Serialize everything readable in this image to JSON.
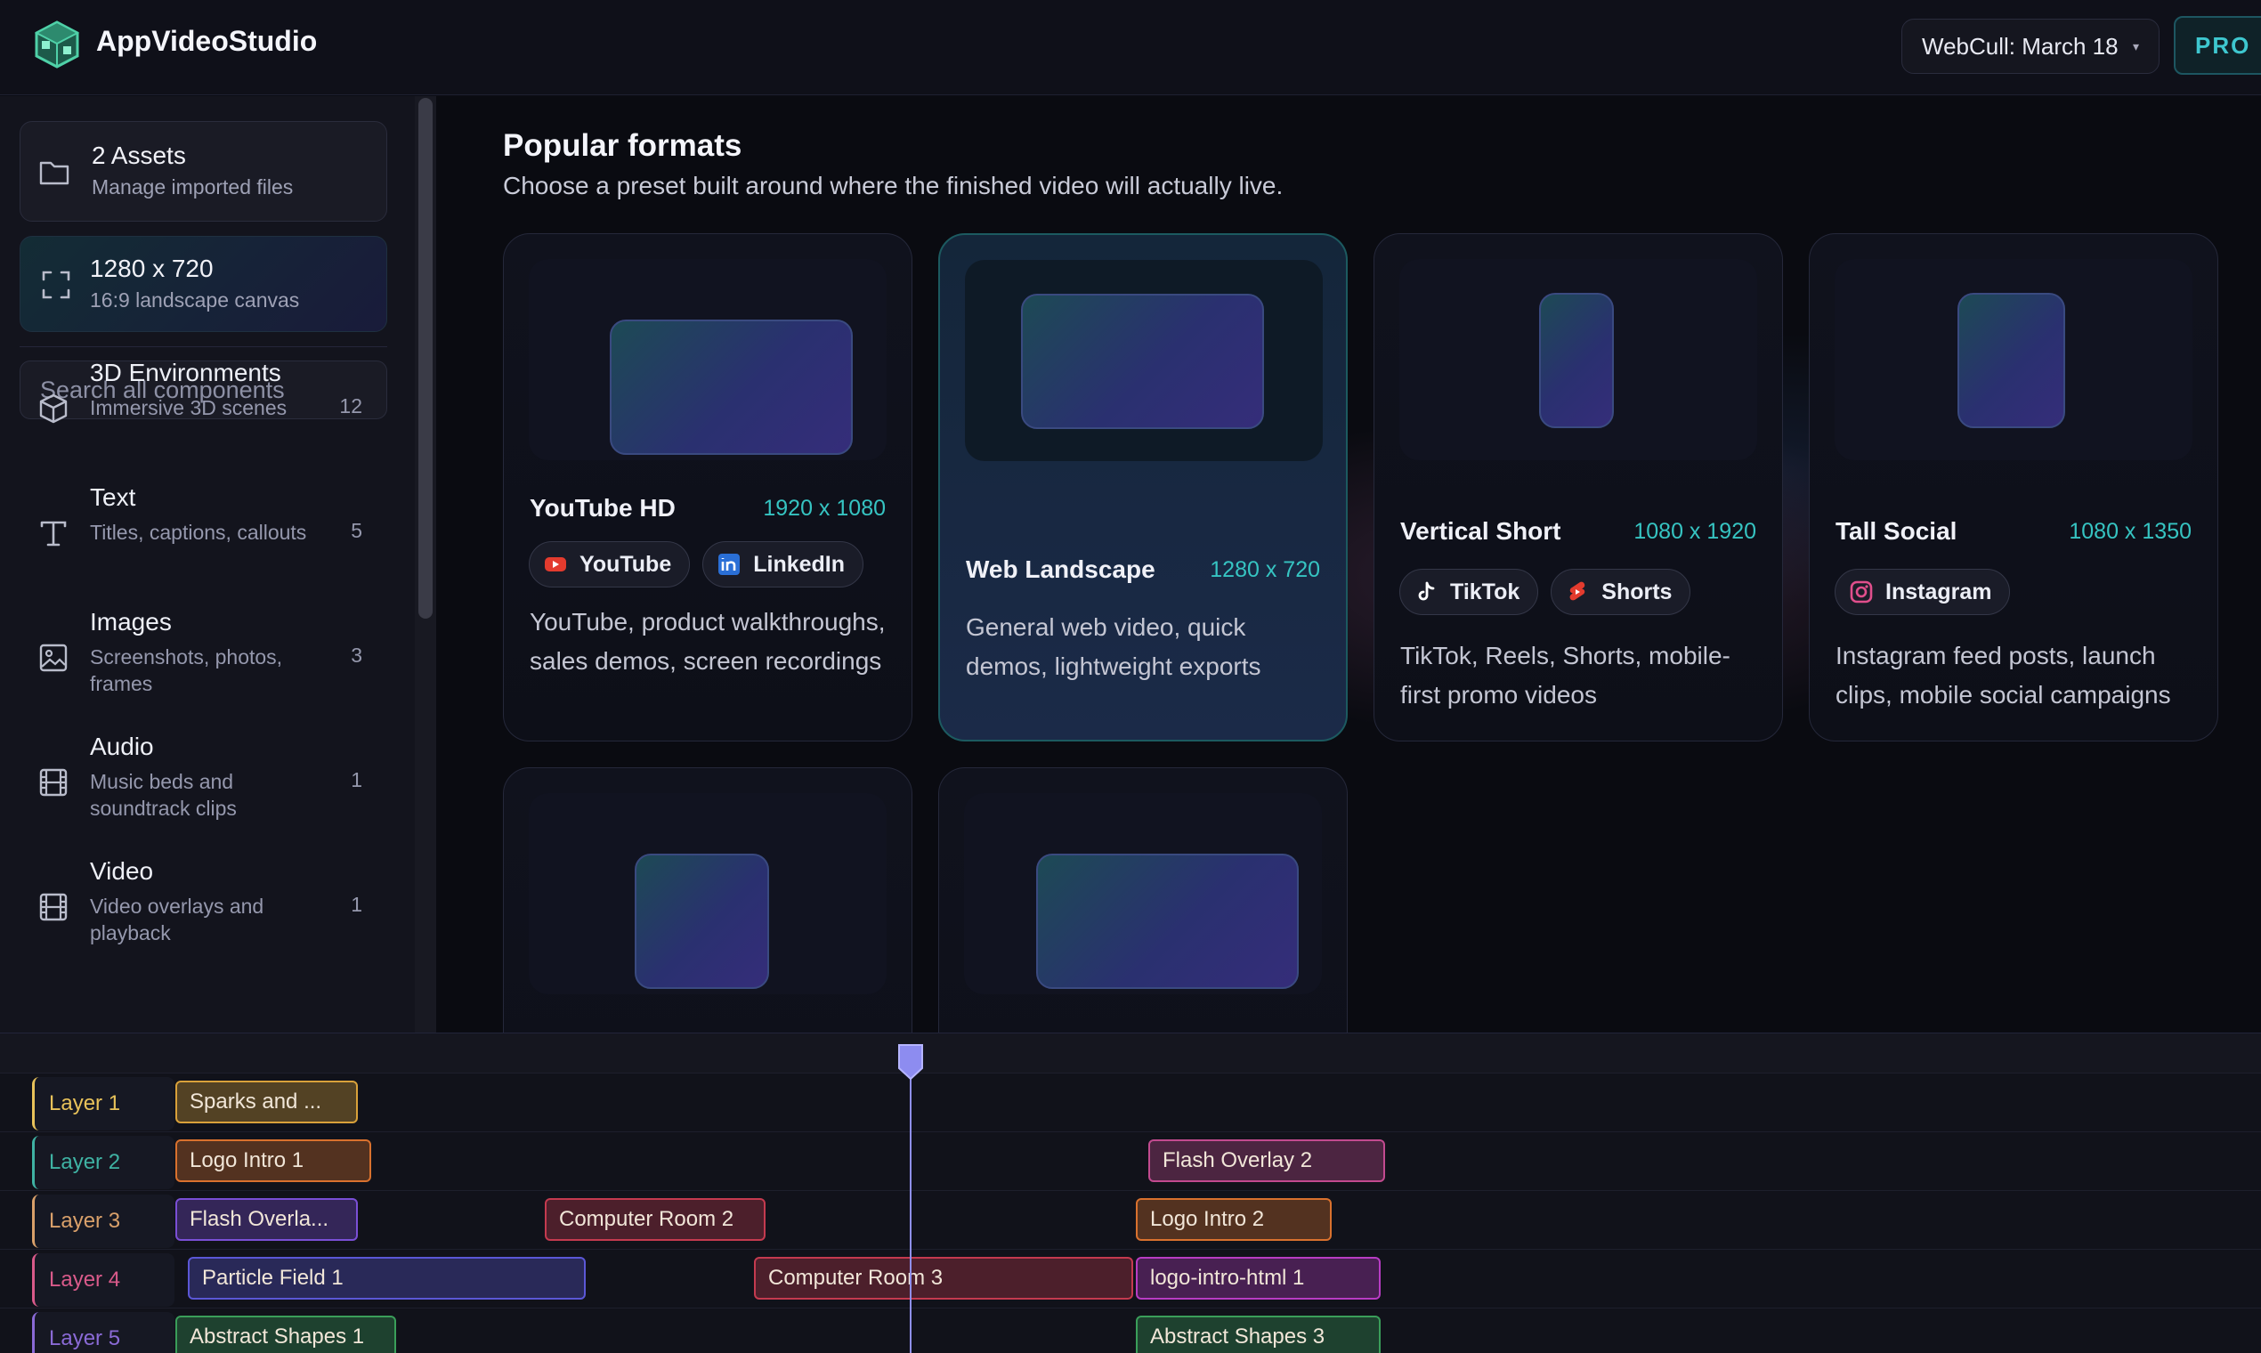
{
  "app": {
    "name": "AppVideoStudio",
    "logo_icon": "cube-logo-icon"
  },
  "header": {
    "project": "WebCull: March 18",
    "project_caret": "▾",
    "pro_badge": "PRO"
  },
  "sidebar": {
    "assets": {
      "title": "2 Assets",
      "subtitle": "Manage imported files",
      "icon": "folder-icon"
    },
    "canvas": {
      "title": "1280 x 720",
      "subtitle": "16:9 landscape canvas",
      "icon": "expand-icon"
    },
    "search": {
      "placeholder": "Search all components"
    },
    "categories": [
      {
        "name": "3D Environments",
        "desc": "Immersive 3D scenes",
        "count": "12",
        "icon": "cube-icon"
      },
      {
        "name": "Text",
        "desc": "Titles, captions, callouts",
        "count": "5",
        "icon": "text-icon"
      },
      {
        "name": "Images",
        "desc": "Screenshots, photos, frames",
        "count": "3",
        "icon": "image-icon"
      },
      {
        "name": "Audio",
        "desc": "Music beds and soundtrack clips",
        "count": "1",
        "icon": "film-icon"
      },
      {
        "name": "Video",
        "desc": "Video overlays and playback",
        "count": "1",
        "icon": "film-icon"
      }
    ]
  },
  "main": {
    "title": "Popular formats",
    "subtitle": "Choose a preset built around where the finished video will actually live.",
    "formats": [
      {
        "name": "YouTube HD",
        "res": "1920 x 1080",
        "tags": [
          {
            "label": "YouTube",
            "icon": "youtube-icon",
            "color": "#e33b2e"
          },
          {
            "label": "LinkedIn",
            "icon": "linkedin-icon",
            "color": "#2a6fd6"
          }
        ],
        "desc": "YouTube, product walkthroughs, sales demos, screen recordings",
        "selected": false
      },
      {
        "name": "Web Landscape",
        "res": "1280 x 720",
        "tags": [],
        "desc": "General web video, quick demos, lightweight exports",
        "selected": true
      },
      {
        "name": "Vertical Short",
        "res": "1080 x 1920",
        "tags": [
          {
            "label": "TikTok",
            "icon": "tiktok-icon",
            "color": "#ffffff"
          },
          {
            "label": "Shorts",
            "icon": "shorts-icon",
            "color": "#e33b2e"
          }
        ],
        "desc": "TikTok, Reels, Shorts, mobile-first promo videos",
        "selected": false
      },
      {
        "name": "Tall Social",
        "res": "1080 x 1350",
        "tags": [
          {
            "label": "Instagram",
            "icon": "instagram-icon",
            "color": "#e04f8c"
          }
        ],
        "desc": "Instagram feed posts, launch clips, mobile social campaigns",
        "selected": false
      },
      {
        "name": "",
        "res": "",
        "tags": [],
        "desc": "",
        "selected": false
      },
      {
        "name": "",
        "res": "",
        "tags": [],
        "desc": "",
        "selected": false
      }
    ]
  },
  "timeline": {
    "layers": [
      {
        "label": "Layer 1",
        "color": "#e8c25a",
        "clips": [
          {
            "label": "Sparks and ...",
            "color": "#d9a13a"
          }
        ]
      },
      {
        "label": "Layer 2",
        "color": "#3fb2a3",
        "clips": [
          {
            "label": "Logo Intro 1",
            "color": "#d9712e"
          },
          {
            "label": "Flash Overlay 2",
            "color": "#c24a8f"
          }
        ]
      },
      {
        "label": "Layer 3",
        "color": "#d9a06a",
        "clips": [
          {
            "label": "Flash Overla...",
            "color": "#7a4fd6"
          },
          {
            "label": "Computer Room 2",
            "color": "#c43a4f"
          },
          {
            "label": "Logo Intro 2",
            "color": "#d9712e"
          }
        ]
      },
      {
        "label": "Layer 4",
        "color": "#d95a8a",
        "clips": [
          {
            "label": "Particle Field 1",
            "color": "#5b57d6"
          },
          {
            "label": "Computer Room 3",
            "color": "#c43a4f"
          },
          {
            "label": "logo-intro-html 1",
            "color": "#b83cc4"
          }
        ]
      },
      {
        "label": "Layer 5",
        "color": "#8a6ad6",
        "clips": [
          {
            "label": "Abstract Shapes 1",
            "color": "#3a9e5a"
          },
          {
            "label": "Abstract Shapes 3",
            "color": "#3a9e5a"
          }
        ]
      }
    ]
  }
}
